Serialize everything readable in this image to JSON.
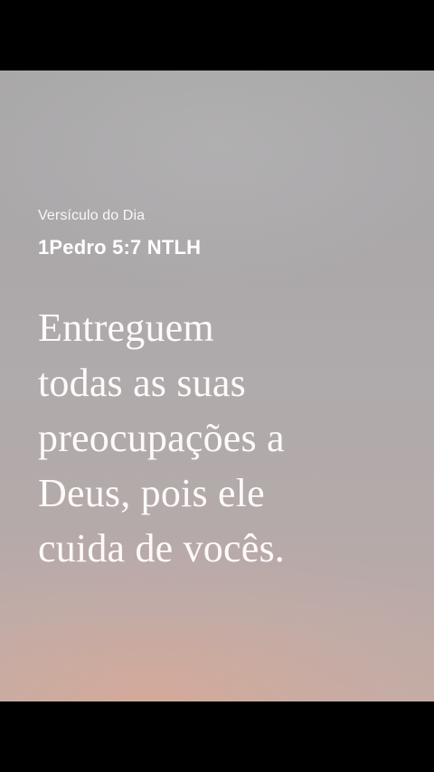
{
  "verse_of_day": {
    "kicker": "Versículo do Dia",
    "reference": "1Pedro 5:7 NTLH",
    "text_lines": [
      "Entreguem",
      "todas as suas",
      "preocupações a",
      "Deus, pois ele",
      "cuida de vocês."
    ]
  },
  "colors": {
    "letterbox": "#000000",
    "text": "#ffffff",
    "background_top": "#a9a8a9",
    "background_bottom_glow": "#d6aa98"
  }
}
